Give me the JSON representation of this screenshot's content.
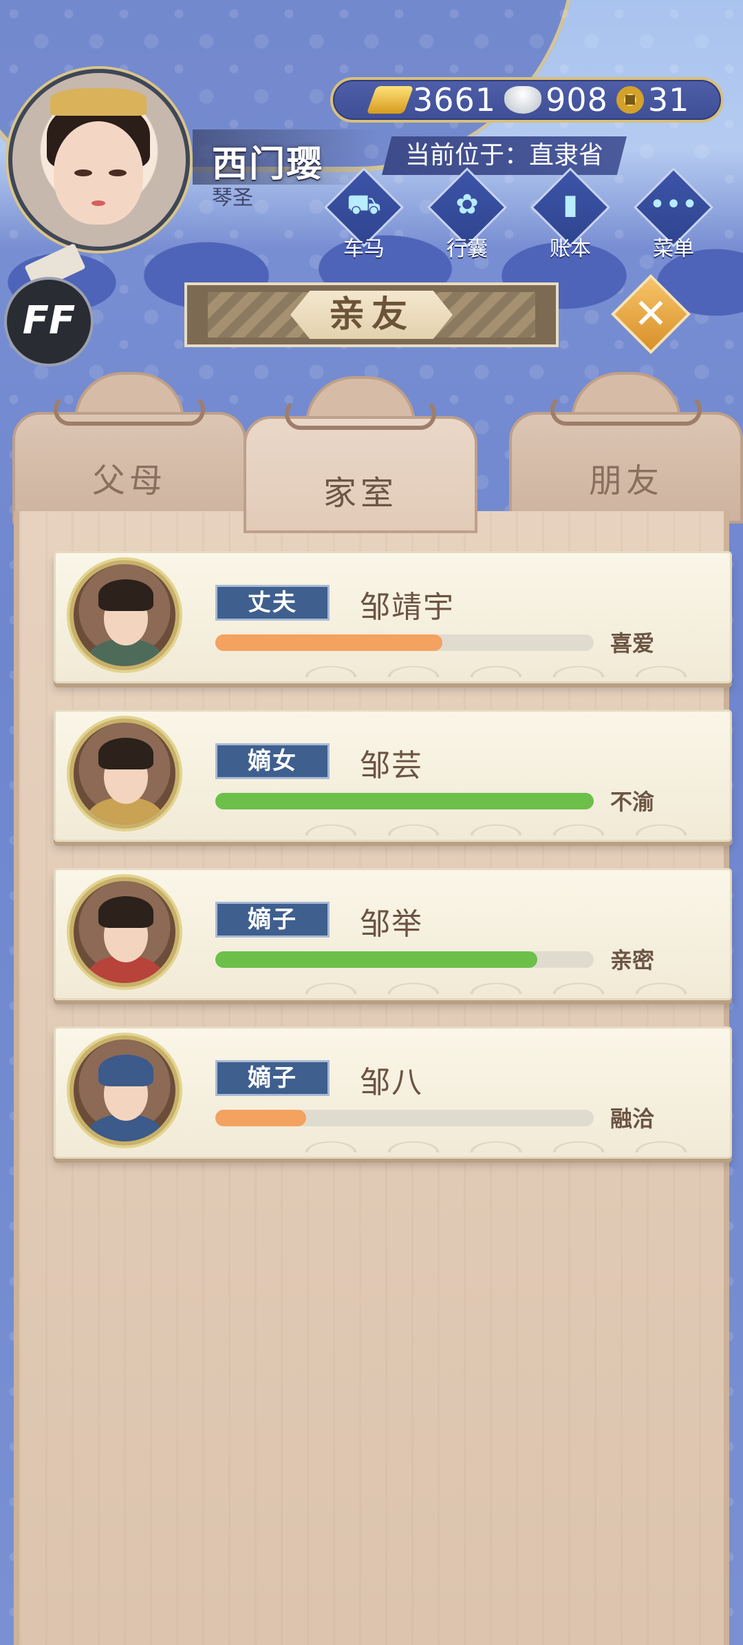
{
  "player": {
    "name": "西门璎",
    "title": "琴圣",
    "location": "当前位于：直隶省"
  },
  "currency": [
    {
      "icon": "gold-ingot-icon",
      "value": "3661"
    },
    {
      "icon": "silver-ingot-icon",
      "value": "908"
    },
    {
      "icon": "copper-coin-icon",
      "value": "31"
    }
  ],
  "top_buttons": [
    {
      "label": "车马",
      "icon": "carriage-icon"
    },
    {
      "label": "行囊",
      "icon": "bag-icon"
    },
    {
      "label": "账本",
      "icon": "ledger-icon"
    },
    {
      "label": "菜单",
      "icon": "menu-icon"
    }
  ],
  "ff_label": "FF",
  "page_title": "亲友",
  "tabs": [
    {
      "label": "父母",
      "active": false
    },
    {
      "label": "家室",
      "active": true
    },
    {
      "label": "朋友",
      "active": false
    }
  ],
  "members": [
    {
      "relation": "丈夫",
      "name": "邹靖宇",
      "status": "喜爱",
      "affinity": 0.6,
      "bar_color": "#f3a25f"
    },
    {
      "relation": "嫡女",
      "name": "邹芸",
      "status": "不渝",
      "affinity": 1.0,
      "bar_color": "#6cc04a"
    },
    {
      "relation": "嫡子",
      "name": "邹举",
      "status": "亲密",
      "affinity": 0.85,
      "bar_color": "#6cc04a"
    },
    {
      "relation": "嫡子",
      "name": "邹八",
      "status": "融洽",
      "affinity": 0.24,
      "bar_color": "#f3a25f"
    }
  ]
}
